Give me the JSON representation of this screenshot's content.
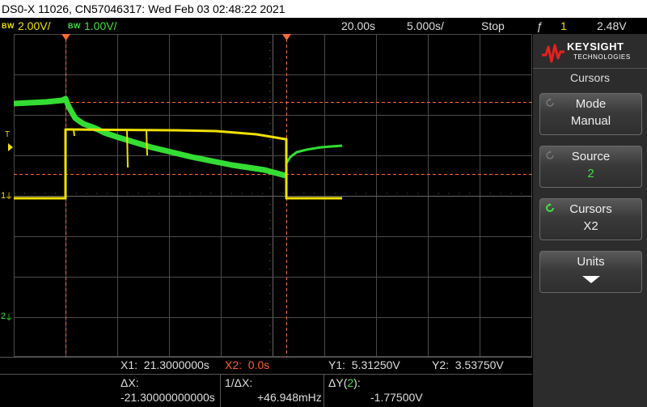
{
  "title": "DS0-X 11026, CN57046317: Wed Feb 03 02:48:22 2021",
  "status": {
    "ch1_bw": "BW",
    "ch1_scale": "2.00V/",
    "ch2_bw": "BW",
    "ch2_scale": "1.00V/",
    "time_position": "20.00s",
    "time_scale": "5.000s/",
    "run_state": "Stop",
    "trigger_symbol": "ƒ",
    "trigger_channel": "1",
    "trigger_level": "2.48V"
  },
  "grid_markers": {
    "trigger_marker": "T",
    "ch1_marker": "1",
    "ch2_marker": "2"
  },
  "panel": {
    "brand": "KEYSIGHT",
    "brand_sub": "TECHNOLOGIES",
    "menu_title": "Cursors",
    "softkeys": [
      {
        "label": "Mode",
        "value": "Manual",
        "icon": "rotate-icon"
      },
      {
        "label": "Source",
        "value": "2",
        "icon": "rotate-icon"
      },
      {
        "label": "Cursors",
        "value": "X2",
        "icon": "rotate-icon-active"
      },
      {
        "label": "Units",
        "value": "",
        "icon": "down-arrow-icon"
      }
    ]
  },
  "readout": {
    "x1_label": "X1:",
    "x1_value": "21.3000000s",
    "x2_label": "X2:",
    "x2_value": "0.0s",
    "y1_label": "Y1:",
    "y1_value": "5.31250V",
    "y2_label": "Y2:",
    "y2_value": "3.53750V",
    "dx_label": "ΔX:",
    "dx_value": "-21.30000000000s",
    "inv_dx_label": "1/ΔX:",
    "inv_dx_value": "+46.948mHz",
    "dy_label_prefix": "ΔY(",
    "dy_channel": "2",
    "dy_label_suffix": "):",
    "dy_value": "-1.77500V"
  },
  "colors": {
    "ch1": "#f0e000",
    "ch2": "#33dd33",
    "cursor": "#ff6a30",
    "grid": "#555555"
  }
}
